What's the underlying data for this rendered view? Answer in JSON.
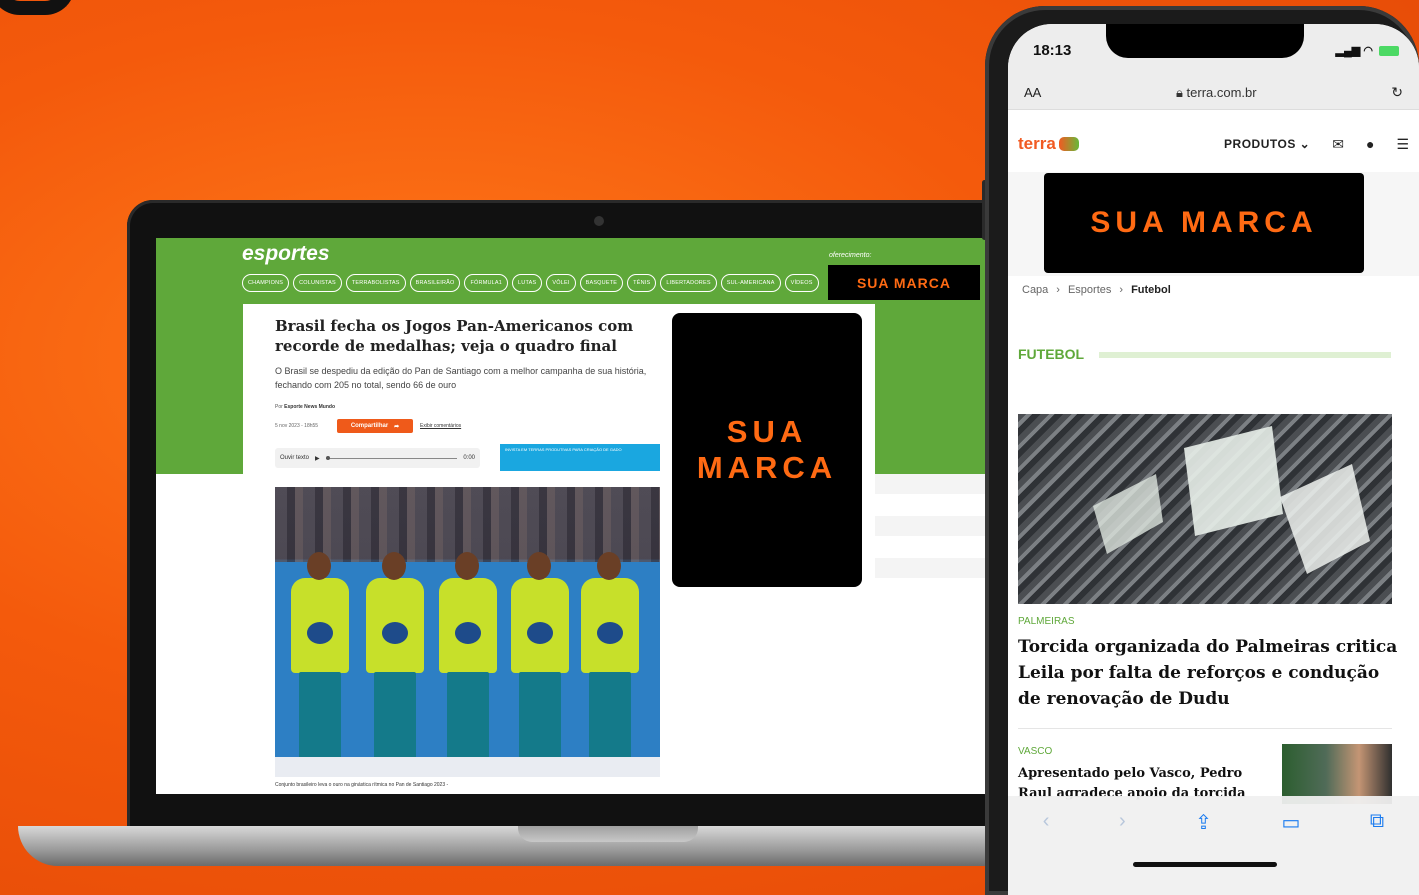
{
  "colors": {
    "background": "#f45a0c",
    "brand_orange": "#ff6a13",
    "site_green": "#5fa83a",
    "brand_card_bg": "#000000"
  },
  "laptop": {
    "site": {
      "brand": "esportes",
      "nav": [
        "CHAMPIONS",
        "COLUNISTAS",
        "TERRABOLISTAS",
        "BRASILEIRÃO",
        "FÓRMULA1",
        "LUTAS",
        "VÔLEI",
        "BASQUETE",
        "TÊNIS",
        "LIBERTADORES",
        "SUL-AMERICANA",
        "VÍDEOS"
      ],
      "sponsor_label": "oferecimento:",
      "sponsor": "SUA MARCA"
    },
    "article": {
      "headline": "Brasil fecha os Jogos Pan-Americanos com recorde de medalhas; veja o quadro final",
      "lede": "O Brasil se despediu da edição do Pan de Santiago com a melhor campanha de sua história, fechando com 205 no total, sendo 66 de ouro",
      "byline_prefix": "Por",
      "byline_author": "Esporte News Mundo",
      "date": "5 nov 2023 - 18h55",
      "share_label": "Compartilhar",
      "comments_label": "Exibir comentários",
      "audio_label": "Ouvir texto",
      "audio_time": "0:00",
      "ad_text": "INVISTA EM TERRAS PRODUTIVAS PARA CRIAÇÃO DE GADO",
      "photo_caption": "Conjunto brasileiro leva o ouro na ginástica rítmica no Pan de Santiago 2023 -"
    },
    "brand_card": {
      "line1": "SUA",
      "line2": "MARCA"
    }
  },
  "phone": {
    "status": {
      "time": "18:13",
      "signal": "▂▄▆"
    },
    "url": "terra.com.br",
    "aa_label": "AA",
    "reload_icon": "↻",
    "header": {
      "logo": "terra",
      "produtos": "PRODUTOS ⌄"
    },
    "brand_banner": "SUA MARCA",
    "breadcrumb": [
      "Capa",
      "Esportes",
      "Futebol"
    ],
    "section": "FUTEBOL",
    "stories": [
      {
        "tag": "PALMEIRAS",
        "title": "Torcida organizada do Palmeiras critica Leila por falta de reforços e condução de renovação de Dudu"
      },
      {
        "tag": "VASCO",
        "title": "Apresentado pelo Vasco, Pedro Raul agradece apoio da torcida"
      }
    ]
  }
}
